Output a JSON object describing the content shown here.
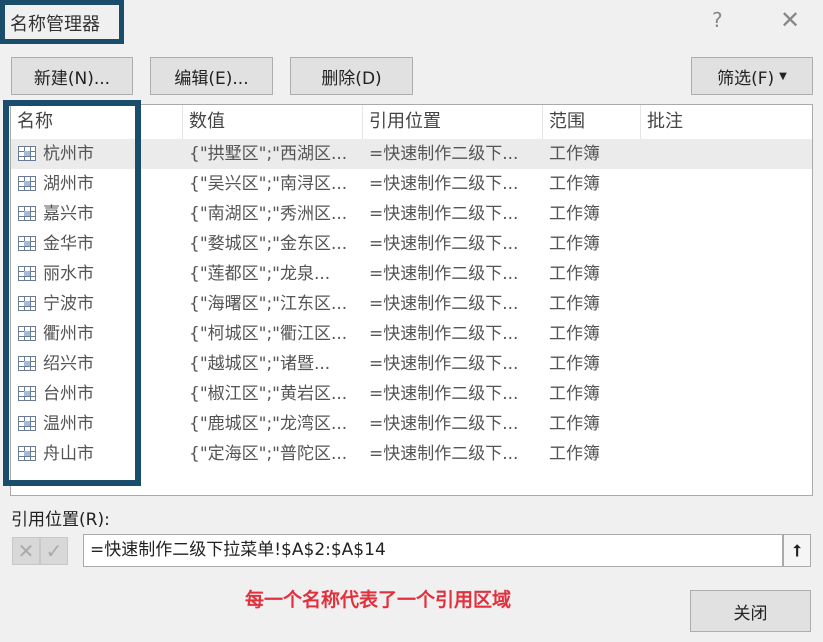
{
  "window": {
    "title": "名称管理器",
    "help": "?",
    "close": "✕"
  },
  "toolbar": {
    "new": "新建(N)...",
    "edit": "编辑(E)...",
    "delete": "删除(D)",
    "filter": "筛选(F)"
  },
  "columns": [
    "名称",
    "数值",
    "引用位置",
    "范围",
    "批注"
  ],
  "rows": [
    {
      "name": "杭州市",
      "value": "{\"拱墅区\";\"西湖区...",
      "ref": "=快速制作二级下...",
      "scope": "工作簿"
    },
    {
      "name": "湖州市",
      "value": "{\"吴兴区\";\"南浔区...",
      "ref": "=快速制作二级下...",
      "scope": "工作簿"
    },
    {
      "name": "嘉兴市",
      "value": "{\"南湖区\";\"秀洲区...",
      "ref": "=快速制作二级下...",
      "scope": "工作簿"
    },
    {
      "name": "金华市",
      "value": "{\"婺城区\";\"金东区...",
      "ref": "=快速制作二级下...",
      "scope": "工作簿"
    },
    {
      "name": "丽水市",
      "value": "{\"莲都区\";\"龙泉...",
      "ref": "=快速制作二级下...",
      "scope": "工作簿"
    },
    {
      "name": "宁波市",
      "value": "{\"海曙区\";\"江东区...",
      "ref": "=快速制作二级下...",
      "scope": "工作簿"
    },
    {
      "name": "衢州市",
      "value": "{\"柯城区\";\"衢江区...",
      "ref": "=快速制作二级下...",
      "scope": "工作簿"
    },
    {
      "name": "绍兴市",
      "value": "{\"越城区\";\"诸暨...",
      "ref": "=快速制作二级下...",
      "scope": "工作簿"
    },
    {
      "name": "台州市",
      "value": "{\"椒江区\";\"黄岩区...",
      "ref": "=快速制作二级下...",
      "scope": "工作簿"
    },
    {
      "name": "温州市",
      "value": "{\"鹿城区\";\"龙湾区...",
      "ref": "=快速制作二级下...",
      "scope": "工作簿"
    },
    {
      "name": "舟山市",
      "value": "{\"定海区\";\"普陀区...",
      "ref": "=快速制作二级下...",
      "scope": "工作簿"
    }
  ],
  "reference": {
    "label": "引用位置(R):",
    "value": "=快速制作二级下拉菜单!$A$2:$A$14",
    "cancel": "✕",
    "confirm": "✓",
    "collapse": "⭡"
  },
  "annotation": "每一个名称代表了一个引用区域",
  "close_button": "关闭"
}
